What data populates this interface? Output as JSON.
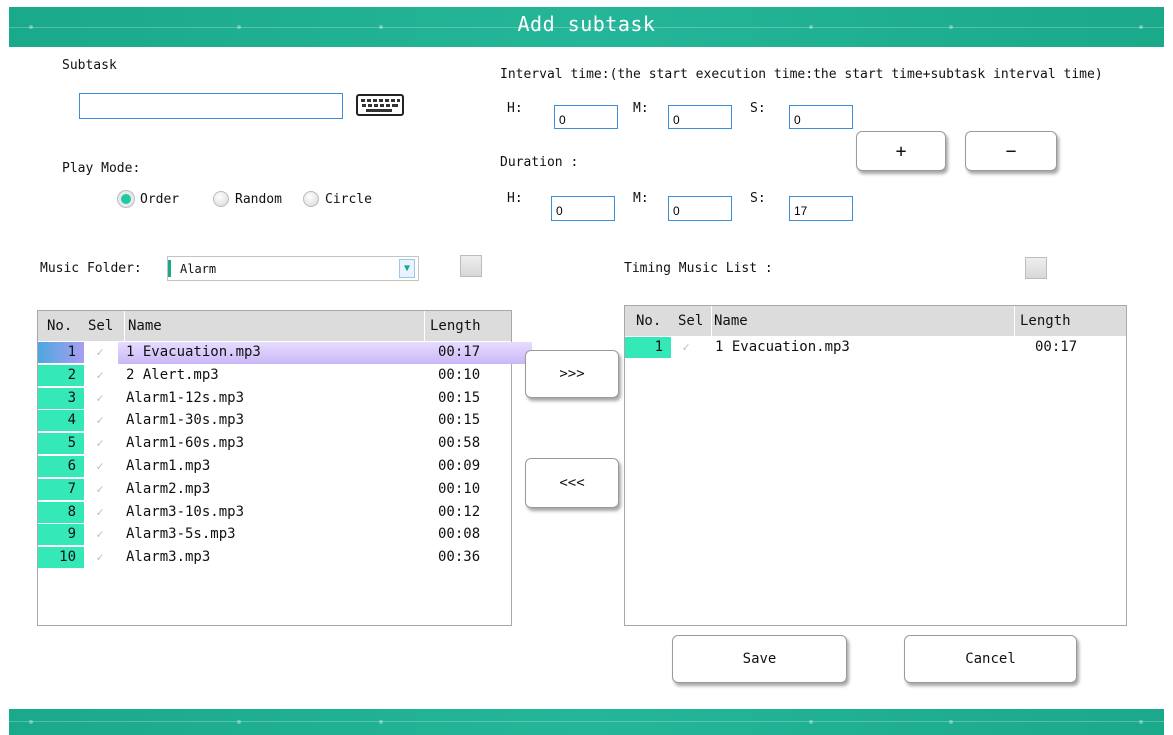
{
  "window": {
    "title": "Add subtask"
  },
  "subtask": {
    "label": "Subtask",
    "value": ""
  },
  "play_mode": {
    "label": "Play Mode:",
    "options": [
      {
        "label": "Order",
        "selected": true
      },
      {
        "label": "Random",
        "selected": false
      },
      {
        "label": "Circle",
        "selected": false
      }
    ]
  },
  "interval": {
    "label": "Interval time:(the start execution time:the start time+subtask interval time)",
    "h_label": "H:",
    "h": "0",
    "m_label": "M:",
    "m": "0",
    "s_label": "S:",
    "s": "0"
  },
  "duration": {
    "label": "Duration :",
    "h_label": "H:",
    "h": "0",
    "m_label": "M:",
    "m": "0",
    "s_label": "S:",
    "s": "17"
  },
  "buttons": {
    "plus": "+",
    "minus": "−",
    "add": ">>>",
    "remove": "<<<",
    "save": "Save",
    "cancel": "Cancel"
  },
  "music_folder": {
    "label": "Music Folder:",
    "value": "Alarm"
  },
  "timing_list": {
    "label": "Timing Music List :"
  },
  "table_headers": {
    "no": "No.",
    "sel": "Sel",
    "name": "Name",
    "length": "Length"
  },
  "music_list": [
    {
      "no": "1",
      "name": "1 Evacuation.mp3",
      "length": "00:17",
      "selected": true
    },
    {
      "no": "2",
      "name": "2 Alert.mp3",
      "length": "00:10",
      "selected": false
    },
    {
      "no": "3",
      "name": "Alarm1-12s.mp3",
      "length": "00:15",
      "selected": false
    },
    {
      "no": "4",
      "name": "Alarm1-30s.mp3",
      "length": "00:15",
      "selected": false
    },
    {
      "no": "5",
      "name": "Alarm1-60s.mp3",
      "length": "00:58",
      "selected": false
    },
    {
      "no": "6",
      "name": "Alarm1.mp3",
      "length": "00:09",
      "selected": false
    },
    {
      "no": "7",
      "name": "Alarm2.mp3",
      "length": "00:10",
      "selected": false
    },
    {
      "no": "8",
      "name": "Alarm3-10s.mp3",
      "length": "00:12",
      "selected": false
    },
    {
      "no": "9",
      "name": "Alarm3-5s.mp3",
      "length": "00:08",
      "selected": false
    },
    {
      "no": "10",
      "name": "Alarm3.mp3",
      "length": "00:36",
      "selected": false
    }
  ],
  "timing_music_list": [
    {
      "no": "1",
      "name": "1 Evacuation.mp3",
      "length": "00:17"
    }
  ],
  "colors": {
    "accent": "#1aa98a",
    "row_number": "#35e8b8",
    "input_border": "#3a8fd8"
  }
}
